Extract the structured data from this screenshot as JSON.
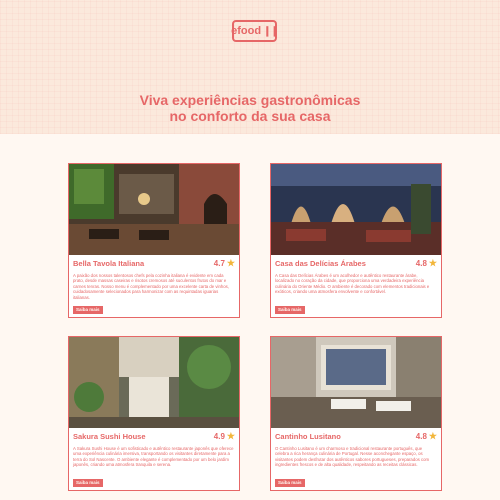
{
  "header": {
    "logo_text": "efood",
    "logo_icon": "fork-knife-icon",
    "headline_line1": "Viva experiências gastronômicas",
    "headline_line2": "no conforto da sua casa"
  },
  "colors": {
    "accent": "#e66767",
    "background": "#fff8f2",
    "star": "#f2b63a"
  },
  "restaurants": [
    {
      "name": "Bella Tavola Italiana",
      "rating": "4.7",
      "description": "A paixão dos nossos talentosos chefs pela cozinha italiana é evidente em cada prato, desde massas caseiras e risotos cremosos até suculentos frutos do mar e carnes tenras. Nosso menu é complementado por uma excelente carta de vinhos, cuidadosamente selecionados para harmonizar com as requintadas iguarias italianas.",
      "button": "Saiba mais"
    },
    {
      "name": "Casa das Delícias Árabes",
      "rating": "4.8",
      "description": "A Casa das Delícias Árabes é um acolhedor e autêntico restaurante árabe, localizado no coração da cidade, que proporciona uma verdadeira experiência culinária do Oriente Médio. O ambiente é decorado com elementos tradicionais e exóticos, criando uma atmosfera envolvente e confortável.",
      "button": "Saiba mais"
    },
    {
      "name": "Sakura Sushi House",
      "rating": "4.9",
      "description": "A Sakura Sushi House é um sofisticado e autêntico restaurante japonês que oferece uma experiência culinária imersiva, transportando os visitantes diretamente para a terra do Sol Nascente. O ambiente elegante é complementado por um belo jardim japonês, criando uma atmosfera tranquila e serena.",
      "button": "Saiba mais"
    },
    {
      "name": "Cantinho Lusitano",
      "rating": "4.8",
      "description": "O Cantinho Lusitano é um charmoso e tradicional restaurante português, que celebra a rica herança culinária de Portugal. Nesse aconchegante espaço, os visitantes podem desfrutar dos autênticos sabores portugueses, preparados com ingredientes frescos e de alta qualidade, respeitando as receitas clássicas.",
      "button": "Saiba mais"
    }
  ]
}
